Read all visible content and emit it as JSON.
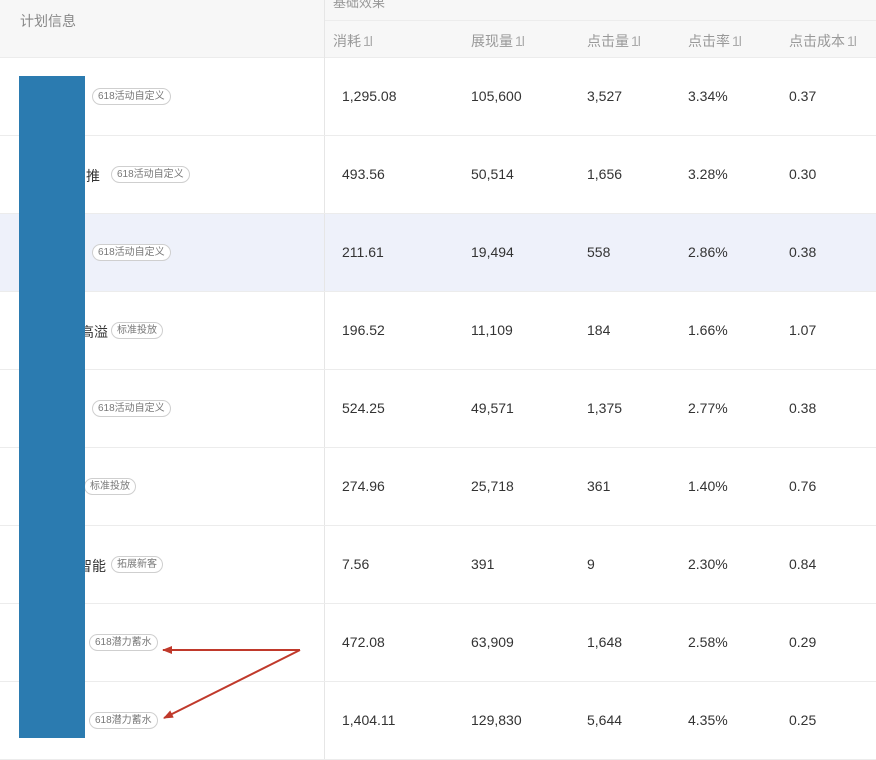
{
  "left_header": {
    "title": "计划信息"
  },
  "group_header": {
    "title": "基础效果"
  },
  "columns": [
    {
      "label": "消耗"
    },
    {
      "label": "展现量"
    },
    {
      "label": "点击量"
    },
    {
      "label": "点击率"
    },
    {
      "label": "点击成本"
    }
  ],
  "sort_glyph": "1l",
  "rows": [
    {
      "name": "",
      "tag": "618活动自定义",
      "cost": "1,295.08",
      "impressions": "105,600",
      "clicks": "3,527",
      "ctr": "3.34%",
      "cpc": "0.37"
    },
    {
      "name": "推",
      "tag": "618活动自定义",
      "cost": "493.56",
      "impressions": "50,514",
      "clicks": "1,656",
      "ctr": "3.28%",
      "cpc": "0.30"
    },
    {
      "name": "",
      "tag": "618活动自定义",
      "cost": "211.61",
      "impressions": "19,494",
      "clicks": "558",
      "ctr": "2.86%",
      "cpc": "0.38"
    },
    {
      "name": "高溢",
      "tag": "标准投放",
      "cost": "196.52",
      "impressions": "11,109",
      "clicks": "184",
      "ctr": "1.66%",
      "cpc": "1.07"
    },
    {
      "name": "",
      "tag": "618活动自定义",
      "cost": "524.25",
      "impressions": "49,571",
      "clicks": "1,375",
      "ctr": "2.77%",
      "cpc": "0.38"
    },
    {
      "name": "",
      "tag": "标准投放",
      "cost": "274.96",
      "impressions": "25,718",
      "clicks": "361",
      "ctr": "1.40%",
      "cpc": "0.76"
    },
    {
      "name": "智能",
      "tag": "拓展新客",
      "cost": "7.56",
      "impressions": "391",
      "clicks": "9",
      "ctr": "2.30%",
      "cpc": "0.84"
    },
    {
      "name": "",
      "tag": "618潜力蓄水",
      "cost": "472.08",
      "impressions": "63,909",
      "clicks": "1,648",
      "ctr": "2.58%",
      "cpc": "0.29"
    },
    {
      "name": "",
      "tag": "618潜力蓄水",
      "cost": "1,404.11",
      "impressions": "129,830",
      "clicks": "5,644",
      "ctr": "4.35%",
      "cpc": "0.25"
    }
  ],
  "colors": {
    "mask": "#2b7bb0",
    "highlight_row": "#eef1fa",
    "annotation_arrow": "#c0392b",
    "header_bg": "#f7f7f7"
  }
}
